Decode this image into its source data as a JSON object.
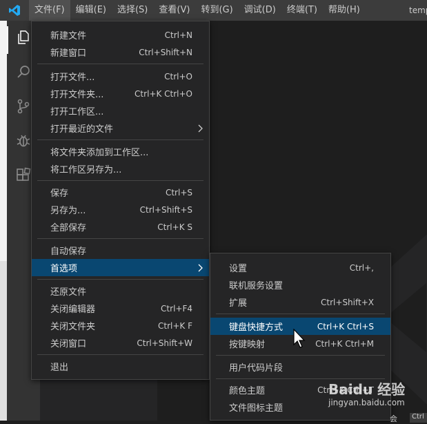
{
  "titlebar": {
    "menu": [
      "文件(F)",
      "编辑(E)",
      "选择(S)",
      "查看(V)",
      "转到(G)",
      "调试(D)",
      "终端(T)",
      "帮助(H)"
    ],
    "window_title": "temp"
  },
  "activity_bar": {
    "icons": [
      "explorer-icon",
      "search-icon",
      "source-control-icon",
      "debug-icon",
      "extensions-icon"
    ]
  },
  "file_menu": {
    "items": [
      {
        "label": "新建文件",
        "shortcut": "Ctrl+N"
      },
      {
        "label": "新建窗口",
        "shortcut": "Ctrl+Shift+N"
      },
      {
        "label": "打开文件...",
        "shortcut": "Ctrl+O"
      },
      {
        "label": "打开文件夹...",
        "shortcut": "Ctrl+K Ctrl+O"
      },
      {
        "label": "打开工作区...",
        "shortcut": ""
      },
      {
        "label": "打开最近的文件",
        "shortcut": ""
      },
      {
        "label": "将文件夹添加到工作区...",
        "shortcut": ""
      },
      {
        "label": "将工作区另存为...",
        "shortcut": ""
      },
      {
        "label": "保存",
        "shortcut": "Ctrl+S"
      },
      {
        "label": "另存为...",
        "shortcut": "Ctrl+Shift+S"
      },
      {
        "label": "全部保存",
        "shortcut": "Ctrl+K S"
      },
      {
        "label": "自动保存",
        "shortcut": ""
      },
      {
        "label": "首选项",
        "shortcut": ""
      },
      {
        "label": "还原文件",
        "shortcut": ""
      },
      {
        "label": "关闭编辑器",
        "shortcut": "Ctrl+F4"
      },
      {
        "label": "关闭文件夹",
        "shortcut": "Ctrl+K F"
      },
      {
        "label": "关闭窗口",
        "shortcut": "Ctrl+Shift+W"
      },
      {
        "label": "退出",
        "shortcut": ""
      }
    ]
  },
  "prefs_menu": {
    "items": [
      {
        "label": "设置",
        "shortcut": "Ctrl+,"
      },
      {
        "label": "联机服务设置",
        "shortcut": ""
      },
      {
        "label": "扩展",
        "shortcut": "Ctrl+Shift+X"
      },
      {
        "label": "键盘快捷方式",
        "shortcut": "Ctrl+K Ctrl+S"
      },
      {
        "label": "按键映射",
        "shortcut": "Ctrl+K Ctrl+M"
      },
      {
        "label": "用户代码片段",
        "shortcut": ""
      },
      {
        "label": "颜色主题",
        "shortcut": "Ctrl+K Ctrl+T"
      },
      {
        "label": "文件图标主题",
        "shortcut": ""
      }
    ]
  },
  "colors": {
    "accent_active": "#094771",
    "menu_bg": "#252526",
    "titlebar_bg": "#3c3c3c"
  },
  "watermark": {
    "brand": "Baidu 经验",
    "url": "jingyan.baidu.com"
  },
  "status_fragment": {
    "hint": "会",
    "pill": "Ctrl"
  }
}
